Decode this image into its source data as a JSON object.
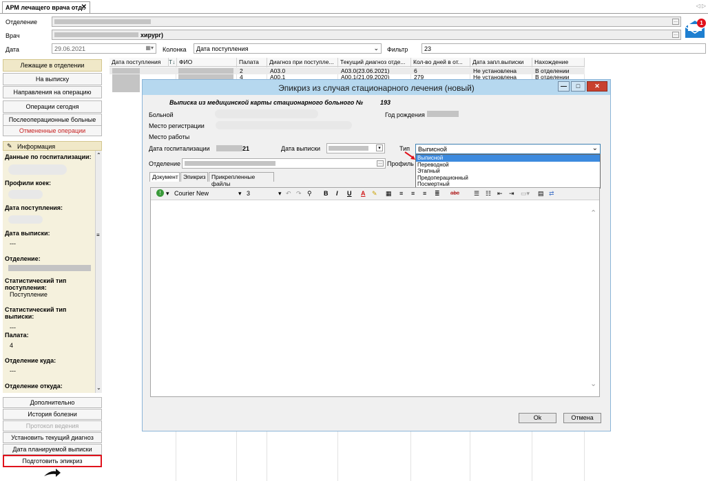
{
  "tab": {
    "title": "АРМ лечащего врача отд..",
    "close": "✕",
    "nav": "◁ ▷"
  },
  "filters": {
    "dept_label": "Отделение",
    "doctor_label": "Врач",
    "doctor_value_suffix": "хирург)",
    "date_label": "Дата",
    "date_value": "29.06.2021",
    "column_label": "Колонка",
    "column_value": "Дата поступления",
    "filter_label": "Фильтр",
    "filter_value": "23",
    "mail_badge": "1"
  },
  "left_nav": {
    "buttons": [
      "Лежащие в отделении",
      "На выписку",
      "Направления на операцию",
      "Операции сегодня",
      "Послеоперационные больные",
      "Отмененные операции"
    ],
    "info_title": "Информация",
    "info": [
      {
        "h": "Данные по госпитализации:",
        "v": ""
      },
      {
        "h": "Профили коек:",
        "v": ""
      },
      {
        "h": "Дата поступления:",
        "v": ""
      },
      {
        "h": "Дата выписки:",
        "v": "---"
      },
      {
        "h": "Отделение:",
        "v": ""
      },
      {
        "h": "Статистический тип поступления:",
        "v": "Поступление"
      },
      {
        "h": "Статистический тип выписки:",
        "v": "---"
      },
      {
        "h": "Палата:",
        "v": "4"
      },
      {
        "h": "Отделение куда:",
        "v": "---"
      },
      {
        "h": "Отделение откуда:",
        "v": ""
      }
    ],
    "bottom": [
      "Дополнительно",
      "История болезни",
      "Протокол ведения",
      "Установить текущий диагноз",
      "Дата планируемой выписки",
      "Подготовить эпикриз"
    ]
  },
  "grid": {
    "headers": [
      "Дата поступления",
      "ФИО",
      "Палата",
      "Диагноз при поступле...",
      "Текущий диагноз отде...",
      "Кол-во дней в от...",
      "Дата запл.выписки",
      "Нахождение"
    ],
    "sort_icon": "T↓",
    "rows": [
      [
        "",
        "",
        "2",
        "A03.0",
        "A03.0(23.06.2021)",
        "6",
        "Не установлена",
        "В отделении"
      ],
      [
        "",
        "",
        "4",
        "A00.1",
        "A00.1(21.09.2020)",
        "279",
        "Не установлена",
        "В отделении"
      ]
    ]
  },
  "dialog": {
    "title": "Эпикриз из случая стационарного лечения (новый)",
    "min": "—",
    "max": "□",
    "close": "✕",
    "heading": "Выписка из медицинской карты стационарного больного №",
    "card_number": "193",
    "patient_label": "Больной",
    "birth_label": "Год рождения",
    "reg_label": "Место регистрации",
    "work_label": "Место работы",
    "hosp_date_label": "Дата госпитализации",
    "hosp_date_suffix": "21",
    "discharge_label": "Дата выписки",
    "type_label": "Тип",
    "type_value": "Выписной",
    "type_options": [
      "Выписной",
      "Переводной",
      "Этапный",
      "Предоперационный",
      "Посмертный"
    ],
    "dept_label": "Отделение",
    "profile_label": "Профиль",
    "tabs": [
      "Документ",
      "Эпикриз",
      "Прикрепленные файлы"
    ],
    "font_name": "Courier New",
    "font_size": "3",
    "ok": "Ok",
    "cancel": "Отмена"
  },
  "colors": {
    "accent": "#3c8ade",
    "highlight": "#e0121c",
    "title_bar": "#b6d8ef"
  }
}
